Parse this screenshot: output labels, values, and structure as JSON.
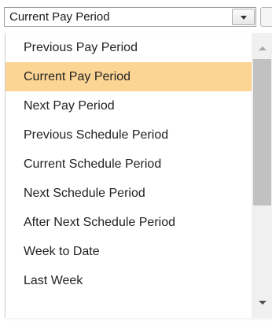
{
  "combo": {
    "value": "Current Pay Period",
    "button_icon": "chevron-down-icon"
  },
  "dropdown": {
    "items": [
      {
        "label": "Previous Pay Period"
      },
      {
        "label": "Current Pay Period"
      },
      {
        "label": "Next Pay Period"
      },
      {
        "label": "Previous Schedule Period"
      },
      {
        "label": "Current Schedule Period"
      },
      {
        "label": "Next Schedule Period"
      },
      {
        "label": "After Next Schedule Period"
      },
      {
        "label": "Week to Date"
      },
      {
        "label": "Last Week"
      }
    ],
    "selected_label": "Current Pay Period"
  },
  "colors": {
    "highlight": "#fcd595",
    "scroll_thumb": "#c1c1c1",
    "scroll_track": "#f0f0f0"
  }
}
